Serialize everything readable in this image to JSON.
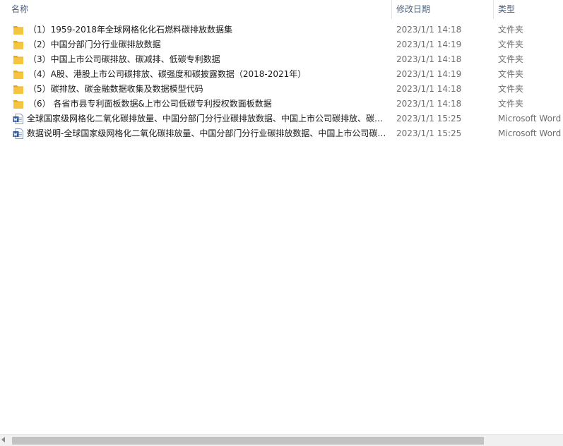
{
  "header": {
    "name_label": "名称",
    "date_label": "修改日期",
    "type_label": "类型"
  },
  "files": [
    {
      "icon": "folder-icon",
      "name": "（1）1959-2018年全球网格化化石燃料碳排放数据集",
      "date": "2023/1/1 14:18",
      "type": "文件夹"
    },
    {
      "icon": "folder-icon",
      "name": "（2）中国分部门分行业碳排放数据",
      "date": "2023/1/1 14:19",
      "type": "文件夹"
    },
    {
      "icon": "folder-icon",
      "name": "（3）中国上市公司碳排放、碳减排、低碳专利数据",
      "date": "2023/1/1 14:18",
      "type": "文件夹"
    },
    {
      "icon": "folder-icon",
      "name": "（4）A股、港股上市公司碳排放、碳强度和碳披露数据（2018-2021年）",
      "date": "2023/1/1 14:19",
      "type": "文件夹"
    },
    {
      "icon": "folder-icon",
      "name": "（5）碳排放、碳金融数据收集及数据模型代码",
      "date": "2023/1/1 14:18",
      "type": "文件夹"
    },
    {
      "icon": "folder-icon",
      "name": "（6） 各省市县专利面板数据&上市公司低碳专利授权数面板数据",
      "date": "2023/1/1 14:18",
      "type": "文件夹"
    },
    {
      "icon": "word-doc-icon",
      "name": "全球国家级网格化二氧化碳排放量、中国分部门分行业碳排放数据、中国上市公司碳排放、碳…",
      "date": "2023/1/1 15:25",
      "type": "Microsoft Word"
    },
    {
      "icon": "word-doc-icon",
      "name": "数据说明-全球国家级网格化二氧化碳排放量、中国分部门分行业碳排放数据、中国上市公司碳…",
      "date": "2023/1/1 15:25",
      "type": "Microsoft Word"
    }
  ],
  "colors": {
    "folder": "#f5c542",
    "folder_dark": "#e3ab1c",
    "word_blue": "#2b579a",
    "header_text": "#4c607a"
  }
}
